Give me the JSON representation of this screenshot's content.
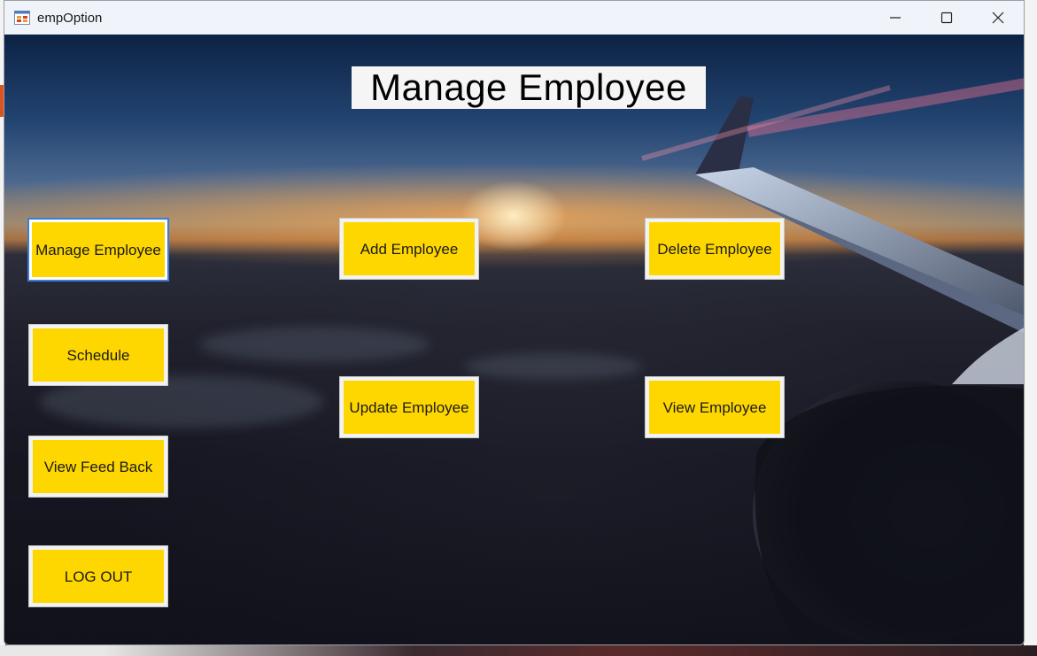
{
  "window": {
    "title": "empOption",
    "app_icon": "form-icon",
    "controls": [
      "minimize-icon",
      "maximize-icon",
      "close-icon"
    ]
  },
  "heading": "Manage Employee",
  "sidebar": {
    "manage_employee": "Manage Employee",
    "schedule": "Schedule",
    "view_feedback": "View Feed Back",
    "logout": "LOG OUT"
  },
  "actions": {
    "add_employee": "Add Employee",
    "update_employee": "Update Employee",
    "delete_employee": "Delete Employee",
    "view_employee": "View Employee"
  },
  "colors": {
    "button_fill": "#ffd700",
    "focus_ring": "#3b7dd8"
  }
}
